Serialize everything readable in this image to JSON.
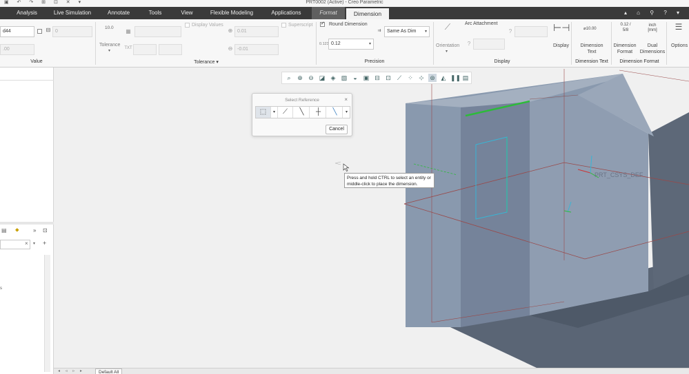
{
  "window": {
    "title": "PRT0002 (Active) - Creo Parametric"
  },
  "menu": {
    "tabs": [
      "Analysis",
      "Live Simulation",
      "Annotate",
      "Tools",
      "View",
      "Flexible Modeling",
      "Applications",
      "Format",
      "Dimension"
    ],
    "active": "Dimension"
  },
  "ribbon": {
    "value": {
      "name_field": "d44",
      "value_field": "0",
      "value2_field": ".00",
      "label": "Value"
    },
    "tolerance": {
      "tol_icon_text": "10.0",
      "tol_label": "Tolerance",
      "display_values": "Display Values",
      "upper": "0.01",
      "lower": "-0.01",
      "superscript": "Superscript",
      "label": "Tolerance"
    },
    "precision": {
      "round_dimension": "Round Dimension",
      "same_as_dim": "Same As Dim",
      "value": "0.12",
      "label": "Precision"
    },
    "display": {
      "orientation": "Orientation",
      "arc_attachment": "Arc Attachment",
      "display_btn": "Display",
      "label": "Display"
    },
    "dimension_text": {
      "button": "Dimension Text",
      "icon_text": "⌀10.00",
      "label": "Dimension Text"
    },
    "dimension_format": {
      "format_btn": "Dimension Format",
      "format_icon": "0.12 / 5/8",
      "dual_btn": "Dual Dimensions",
      "dual_icon": "inch [mm]",
      "label": "Dimension Format"
    },
    "options": {
      "button": "Options"
    }
  },
  "dialog": {
    "title": "Select Reference",
    "cancel": "Cancel"
  },
  "tooltip": {
    "text": "Press and hold CTRL to select an entity or middle-click to place the dimension."
  },
  "model": {
    "csys_label": "PRT_CSYS_DEF"
  },
  "statusbar": {
    "filter": "Default All"
  },
  "colors": {
    "menubar": "#3a3a3a",
    "model_face": "#8796aa",
    "selection_green": "#2dbb3a",
    "edge_cyan": "#37b6d6"
  }
}
